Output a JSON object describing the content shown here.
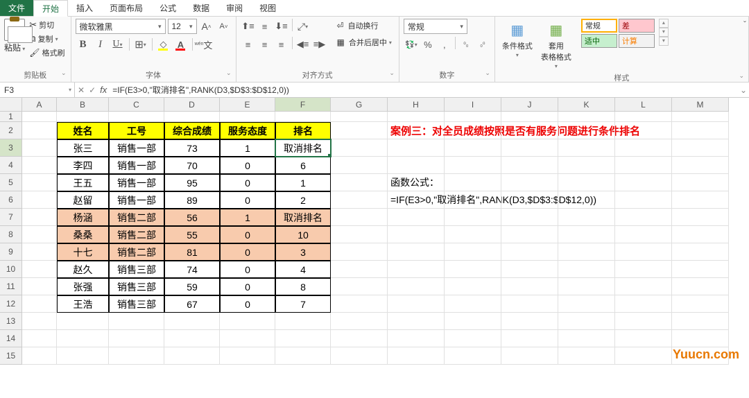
{
  "tabs": {
    "file": "文件",
    "home": "开始",
    "insert": "插入",
    "layout": "页面布局",
    "formulas": "公式",
    "data": "数据",
    "review": "审阅",
    "view": "视图"
  },
  "ribbon": {
    "clipboard": {
      "label": "剪贴板",
      "paste": "粘贴",
      "cut": "剪切",
      "copy": "复制",
      "painter": "格式刷"
    },
    "font": {
      "label": "字体",
      "name": "微软雅黑",
      "size": "12",
      "increase": "A",
      "decrease": "A"
    },
    "alignment": {
      "label": "对齐方式",
      "wrap": "自动换行",
      "merge": "合并后居中"
    },
    "number": {
      "label": "数字",
      "format": "常规"
    },
    "styles": {
      "label": "样式",
      "cond": "条件格式",
      "table": "套用\n表格格式",
      "normal": "常规",
      "bad": "差",
      "good": "适中",
      "calc": "计算"
    }
  },
  "formula_bar": {
    "cell_ref": "F3",
    "formula": "=IF(E3>0,\"取消排名\",RANK(D3,$D$3:$D$12,0))"
  },
  "columns": [
    "A",
    "B",
    "C",
    "D",
    "E",
    "F",
    "G",
    "H",
    "I",
    "J",
    "K",
    "L",
    "M"
  ],
  "row_heights": {
    "1": 15
  },
  "table": {
    "headers": [
      "姓名",
      "工号",
      "综合成绩",
      "服务态度",
      "排名"
    ],
    "rows": [
      {
        "name": "张三",
        "dept": "销售一部",
        "score": 73,
        "attitude": 1,
        "rank": "取消排名",
        "hl": false
      },
      {
        "name": "李四",
        "dept": "销售一部",
        "score": 70,
        "attitude": 0,
        "rank": "6",
        "hl": false
      },
      {
        "name": "王五",
        "dept": "销售一部",
        "score": 95,
        "attitude": 0,
        "rank": "1",
        "hl": false
      },
      {
        "name": "赵留",
        "dept": "销售一部",
        "score": 89,
        "attitude": 0,
        "rank": "2",
        "hl": false
      },
      {
        "name": "杨涵",
        "dept": "销售二部",
        "score": 56,
        "attitude": 1,
        "rank": "取消排名",
        "hl": true
      },
      {
        "name": "桑桑",
        "dept": "销售二部",
        "score": 55,
        "attitude": 0,
        "rank": "10",
        "hl": true
      },
      {
        "name": "十七",
        "dept": "销售二部",
        "score": 81,
        "attitude": 0,
        "rank": "3",
        "hl": true
      },
      {
        "name": "赵久",
        "dept": "销售三部",
        "score": 74,
        "attitude": 0,
        "rank": "4",
        "hl": false
      },
      {
        "name": "张强",
        "dept": "销售三部",
        "score": 59,
        "attitude": 0,
        "rank": "8",
        "hl": false
      },
      {
        "name": "王浩",
        "dept": "销售三部",
        "score": 67,
        "attitude": 0,
        "rank": "7",
        "hl": false
      }
    ]
  },
  "notes": {
    "title": "案例三：对全员成绩按照是否有服务问题进行条件排名",
    "label": "函数公式：",
    "formula": "=IF(E3>0,\"取消排名\",RANK(D3,$D$3:$D$12,0))"
  },
  "watermark": "Yuucn.com",
  "active_cell": "F3",
  "chart_data": null
}
